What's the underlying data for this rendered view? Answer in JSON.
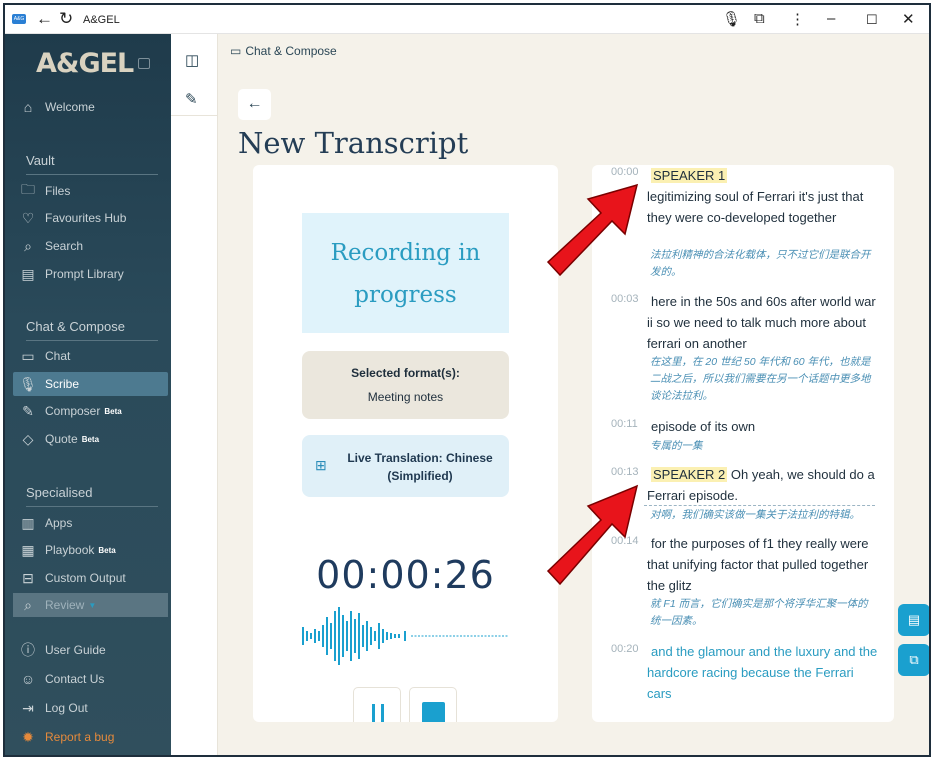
{
  "window": {
    "app_badge": "A&G",
    "title": "A&GEL"
  },
  "sidebar": {
    "logo": "A&GEL",
    "welcome": "Welcome",
    "vault_heading": "Vault",
    "vault_items": [
      {
        "label": "Files",
        "icon": "folder-icon"
      },
      {
        "label": "Favourites Hub",
        "icon": "heart-icon"
      },
      {
        "label": "Search",
        "icon": "search-icon"
      },
      {
        "label": "Prompt Library",
        "icon": "library-icon"
      }
    ],
    "chat_heading": "Chat & Compose",
    "chat_items": [
      {
        "label": "Chat",
        "icon": "chat-icon"
      },
      {
        "label": "Scribe",
        "icon": "microphone-icon",
        "active": true
      },
      {
        "label": "Composer",
        "icon": "pen-icon",
        "badge": "Beta"
      },
      {
        "label": "Quote",
        "icon": "tag-icon",
        "badge": "Beta"
      }
    ],
    "special_heading": "Specialised",
    "special_items": [
      {
        "label": "Apps",
        "icon": "apps-icon"
      },
      {
        "label": "Playbook",
        "icon": "book-icon",
        "badge": "Beta"
      },
      {
        "label": "Custom Output",
        "icon": "custom-output-icon"
      },
      {
        "label": "Review",
        "icon": "review-icon"
      }
    ],
    "footer_items": [
      {
        "label": "User Guide",
        "icon": "info-icon"
      },
      {
        "label": "Contact Us",
        "icon": "contact-icon"
      },
      {
        "label": "Log Out",
        "icon": "logout-icon"
      },
      {
        "label": "Report a bug",
        "icon": "bug-icon"
      }
    ]
  },
  "breadcrumb": "Chat & Compose",
  "page_title": "New Transcript",
  "recorder": {
    "status": "Recording in progress",
    "format_title": "Selected format(s):",
    "format_value": "Meeting notes",
    "translation": "Live Translation: Chinese (Simplified)",
    "timer": "00:00:26"
  },
  "transcript": [
    {
      "time": "00:00",
      "speaker": "SPEAKER 1",
      "text": "legitimizing soul of Ferrari it's just that they were co-developed together",
      "translation": "法拉利精神的合法化载体，只不过它们是联合开发的。"
    },
    {
      "time": "00:03",
      "speaker": "",
      "text": "here in the 50s and 60s after world war ii so we need to talk much more about ferrari on another",
      "translation": "在这里，在 20 世纪 50 年代和 60 年代，也就是二战之后，所以我们需要在另一个话题中更多地谈论法拉利。"
    },
    {
      "time": "00:11",
      "speaker": "",
      "text": "episode of its own",
      "translation": "专属的一集"
    },
    {
      "time": "00:13",
      "speaker": "SPEAKER 2",
      "text": "Oh yeah, we should do a Ferrari episode.",
      "translation": "对啊，我们确实该做一集关于法拉利的特辑。"
    },
    {
      "time": "00:14",
      "speaker": "",
      "text": "for the purposes of f1 they really were that unifying factor that pulled together the glitz",
      "translation": "就 F1 而言，它们确实是那个将浮华汇聚一体的统一因素。"
    },
    {
      "time": "00:20",
      "speaker": "",
      "text": "and the glamour and the luxury and the hardcore racing because the Ferrari cars",
      "translation": ""
    }
  ],
  "colors": {
    "sidebar": "#1f3b4b",
    "accent": "#1aa0cf",
    "speaker_highlight": "#fbf0b2",
    "annotation_arrow": "#e8141b"
  }
}
